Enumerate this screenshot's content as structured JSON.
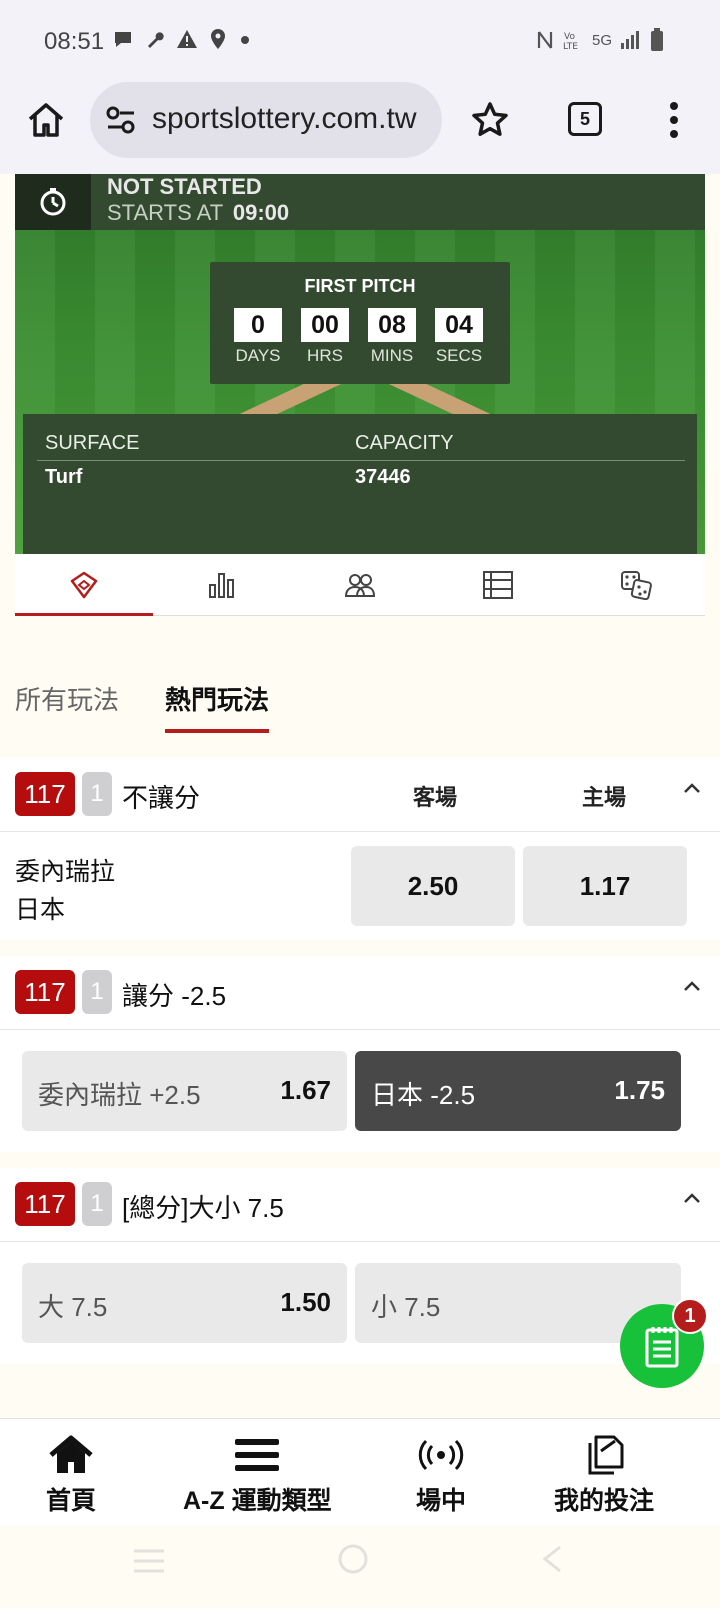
{
  "status_bar": {
    "time": "08:51",
    "network": "5G"
  },
  "browser": {
    "url": "sportslottery.com.tw",
    "tab_count": "5"
  },
  "match": {
    "status": "NOT STARTED",
    "starts_at_label": "STARTS AT",
    "starts_at_time": "09:00",
    "countdown": {
      "title": "FIRST PITCH",
      "days": "0",
      "days_label": "DAYS",
      "hrs": "00",
      "hrs_label": "HRS",
      "mins": "08",
      "mins_label": "MINS",
      "secs": "04",
      "secs_label": "SECS"
    },
    "venue": {
      "surface_label": "SURFACE",
      "surface": "Turf",
      "capacity_label": "CAPACITY",
      "capacity": "37446"
    }
  },
  "icon_tabs": [
    {
      "name": "field-icon",
      "active": true
    },
    {
      "name": "stats-icon",
      "active": false
    },
    {
      "name": "lineup-icon",
      "active": false
    },
    {
      "name": "table-icon",
      "active": false
    },
    {
      "name": "dice-icon",
      "active": false
    }
  ],
  "market_tabs": [
    {
      "label": "所有玩法",
      "active": false
    },
    {
      "label": "熱門玩法",
      "active": true
    }
  ],
  "markets": [
    {
      "code": "117",
      "period": "1",
      "title": "不讓分",
      "col_away": "客場",
      "col_home": "主場",
      "team_away": "委內瑞拉",
      "team_home": "日本",
      "odds_away": "2.50",
      "odds_home": "1.17"
    },
    {
      "code": "117",
      "period": "1",
      "title": "讓分 -2.5",
      "option_a_label": "委內瑞拉 +2.5",
      "option_a_odds": "1.67",
      "option_b_label": "日本 -2.5",
      "option_b_odds": "1.75"
    },
    {
      "code": "117",
      "period": "1",
      "title": "[總分]大小 7.5",
      "option_a_label": "大 7.5",
      "option_a_odds": "1.50",
      "option_b_label": "小 7.5"
    }
  ],
  "betslip": {
    "count": "1"
  },
  "bottom_nav": [
    {
      "label": "首頁",
      "icon": "home-icon"
    },
    {
      "label": "A-Z 運動類型",
      "icon": "menu-icon"
    },
    {
      "label": "場中",
      "icon": "live-icon"
    },
    {
      "label": "我的投注",
      "icon": "mybets-icon"
    }
  ],
  "colors": {
    "brand_red": "#b50d0d",
    "field_green": "#3b8f32",
    "panel_green": "#344a30",
    "fab_green": "#18c13a"
  }
}
